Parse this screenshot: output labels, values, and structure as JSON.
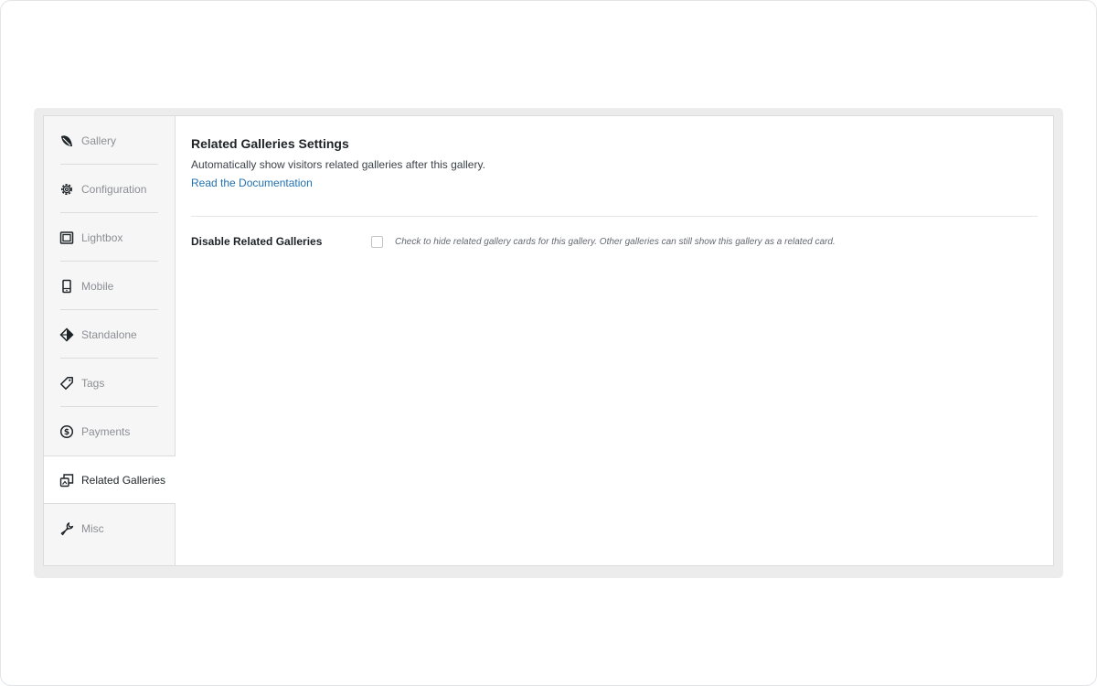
{
  "sidebar": {
    "items": [
      {
        "label": "Gallery",
        "icon": "leaf-icon",
        "active": false
      },
      {
        "label": "Configuration",
        "icon": "gear-icon",
        "active": false
      },
      {
        "label": "Lightbox",
        "icon": "lightbox-icon",
        "active": false
      },
      {
        "label": "Mobile",
        "icon": "mobile-icon",
        "active": false
      },
      {
        "label": "Standalone",
        "icon": "standalone-icon",
        "active": false
      },
      {
        "label": "Tags",
        "icon": "tag-icon",
        "active": false
      },
      {
        "label": "Payments",
        "icon": "dollar-icon",
        "active": false
      },
      {
        "label": "Related Galleries",
        "icon": "related-galleries-icon",
        "active": true
      },
      {
        "label": "Misc",
        "icon": "wrench-icon",
        "active": false
      }
    ]
  },
  "main": {
    "title": "Related Galleries Settings",
    "description": "Automatically show visitors related galleries after this gallery.",
    "doc_link": "Read the Documentation",
    "setting": {
      "label": "Disable Related Galleries",
      "checked": false,
      "help": "Check to hide related gallery cards for this gallery. Other galleries can still show this gallery as a related card."
    }
  },
  "colors": {
    "link": "#2271b1",
    "sidebar_bg": "#f6f6f6",
    "border": "#dcdcde"
  }
}
